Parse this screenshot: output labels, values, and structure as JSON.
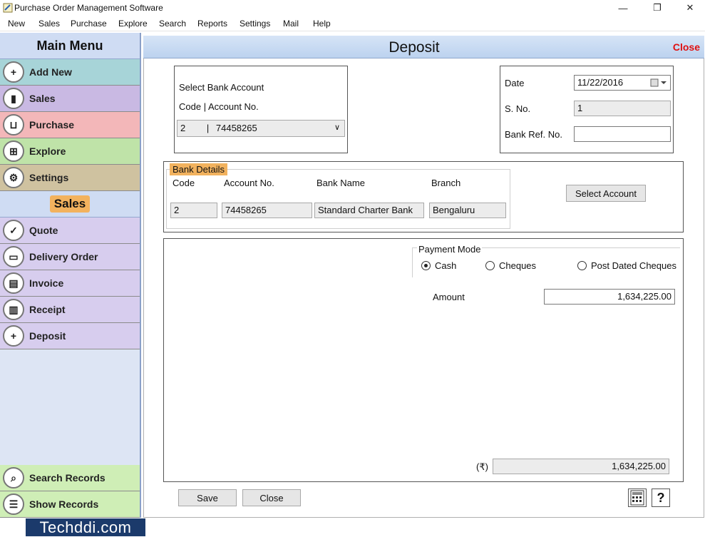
{
  "window": {
    "title": "Purchase Order Management Software",
    "minimize": "—",
    "maximize": "❐",
    "close": "✕"
  },
  "menubar": [
    "New",
    "Sales",
    "Purchase",
    "Explore",
    "Search",
    "Reports",
    "Settings",
    "Mail",
    "Help"
  ],
  "sidebar": {
    "main_menu_title": "Main Menu",
    "main_items": [
      {
        "label": "Add New",
        "icon": "add-new-icon",
        "glyph": "+",
        "color": "#a7d4d8"
      },
      {
        "label": "Sales",
        "icon": "sales-chart-icon",
        "glyph": "▮",
        "color": "#c9b9e3"
      },
      {
        "label": "Purchase",
        "icon": "basket-icon",
        "glyph": "⊔",
        "color": "#f3b7b9"
      },
      {
        "label": "Explore",
        "icon": "explore-icon",
        "glyph": "⊞",
        "color": "#bfe3a8"
      },
      {
        "label": "Settings",
        "icon": "gear-icon",
        "glyph": "⚙",
        "color": "#cfc2a0"
      }
    ],
    "section_title": "Sales",
    "section_items": [
      {
        "label": "Quote",
        "icon": "quote-icon",
        "glyph": "✓"
      },
      {
        "label": "Delivery Order",
        "icon": "delivery-order-icon",
        "glyph": "▭"
      },
      {
        "label": "Invoice",
        "icon": "invoice-icon",
        "glyph": "▤"
      },
      {
        "label": "Receipt",
        "icon": "receipt-icon",
        "glyph": "▥"
      },
      {
        "label": "Deposit",
        "icon": "deposit-icon",
        "glyph": "+"
      }
    ],
    "section_item_color": "#d7cdee",
    "bottom_items": [
      {
        "label": "Search Records",
        "icon": "search-records-icon",
        "glyph": "⌕"
      },
      {
        "label": "Show Records",
        "icon": "show-records-icon",
        "glyph": "☰"
      }
    ],
    "bottom_item_color": "#cfeeb6"
  },
  "page": {
    "title": "Deposit",
    "close_link": "Close"
  },
  "bank_select": {
    "title": "Select Bank Account",
    "code_label": "Code | Account No.",
    "selected_code": "2",
    "selected_separator": "|",
    "selected_account": "74458265",
    "arrow": "∨"
  },
  "header_fields": {
    "date_label": "Date",
    "date_value": "11/22/2016",
    "sno_label": "S. No.",
    "sno_value": "1",
    "bank_ref_label": "Bank Ref. No.",
    "bank_ref_value": ""
  },
  "bank_details": {
    "group_title": "Bank Details",
    "code_label": "Code",
    "code_value": "2",
    "account_label": "Account No.",
    "account_value": "74458265",
    "bank_name_label": "Bank Name",
    "bank_name_value": "Standard Charter Bank",
    "branch_label": "Branch",
    "branch_value": "Bengaluru",
    "select_account_button": "Select Account"
  },
  "payment": {
    "group_title": "Payment Mode",
    "options": [
      "Cash",
      "Cheques",
      "Post Dated Cheques"
    ],
    "selected": "Cash",
    "amount_label": "Amount",
    "amount_value": "1,634,225.00",
    "currency_symbol": "(₹)",
    "total_value": "1,634,225.00"
  },
  "footer": {
    "save_button": "Save",
    "close_button": "Close"
  },
  "watermark": "Techddi.com"
}
